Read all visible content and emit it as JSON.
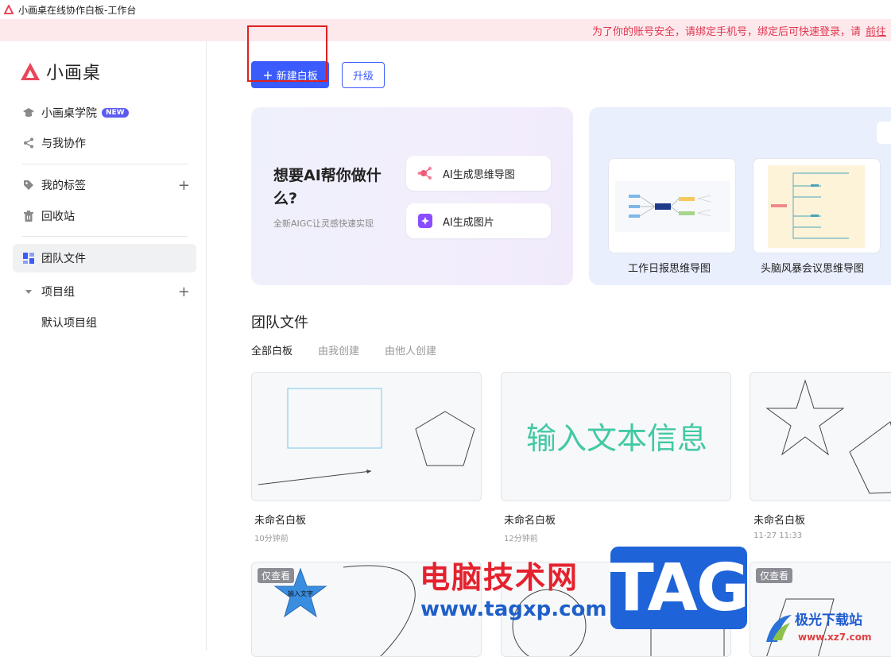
{
  "window": {
    "title": "小画桌在线协作白板-工作台"
  },
  "notice": {
    "text": "为了你的账号安全，请绑定手机号，绑定后可快速登录，请",
    "link": "前往"
  },
  "sidebar": {
    "brand": "小画桌",
    "items": [
      {
        "label": "小画桌学院",
        "badge": "NEW"
      },
      {
        "label": "与我协作"
      },
      {
        "label": "我的标签"
      },
      {
        "label": "回收站"
      },
      {
        "label": "团队文件"
      },
      {
        "label": "项目组"
      },
      {
        "label": "默认项目组"
      }
    ]
  },
  "toolbar": {
    "new_board": "新建白板",
    "upgrade": "升级"
  },
  "ai": {
    "title": "想要AI帮你做什么?",
    "subtitle": "全新AIGC让灵感快速实现",
    "mindmap_btn": "AI生成思维导图",
    "image_btn": "AI生成图片"
  },
  "templates": [
    {
      "label": "工作日报思维导图"
    },
    {
      "label": "头脑风暴会议思维导图"
    }
  ],
  "main": {
    "section_title": "团队文件",
    "tabs": [
      "全部白板",
      "由我创建",
      "由他人创建"
    ]
  },
  "boards": [
    {
      "name": "未命名白板",
      "time": "10分钟前"
    },
    {
      "name": "未命名白板",
      "time": "12分钟前",
      "preview_text": "输入文本信息"
    },
    {
      "name": "未命名白板",
      "time": "11-27 11:33"
    }
  ],
  "boards_row2": [
    {
      "badge": "仅查看",
      "star_text": "输入文字"
    },
    {
      "badge": ""
    },
    {
      "badge": "仅查看"
    }
  ],
  "watermark": {
    "cn": "电脑技术网",
    "url": "www.tagxp.com",
    "tag": "TAG",
    "site2": "极光下载站",
    "url2": "www.xz7.com"
  },
  "colors": {
    "accent": "#3b5bfd",
    "notice": "#e0354f",
    "brand": "#e8485a"
  }
}
